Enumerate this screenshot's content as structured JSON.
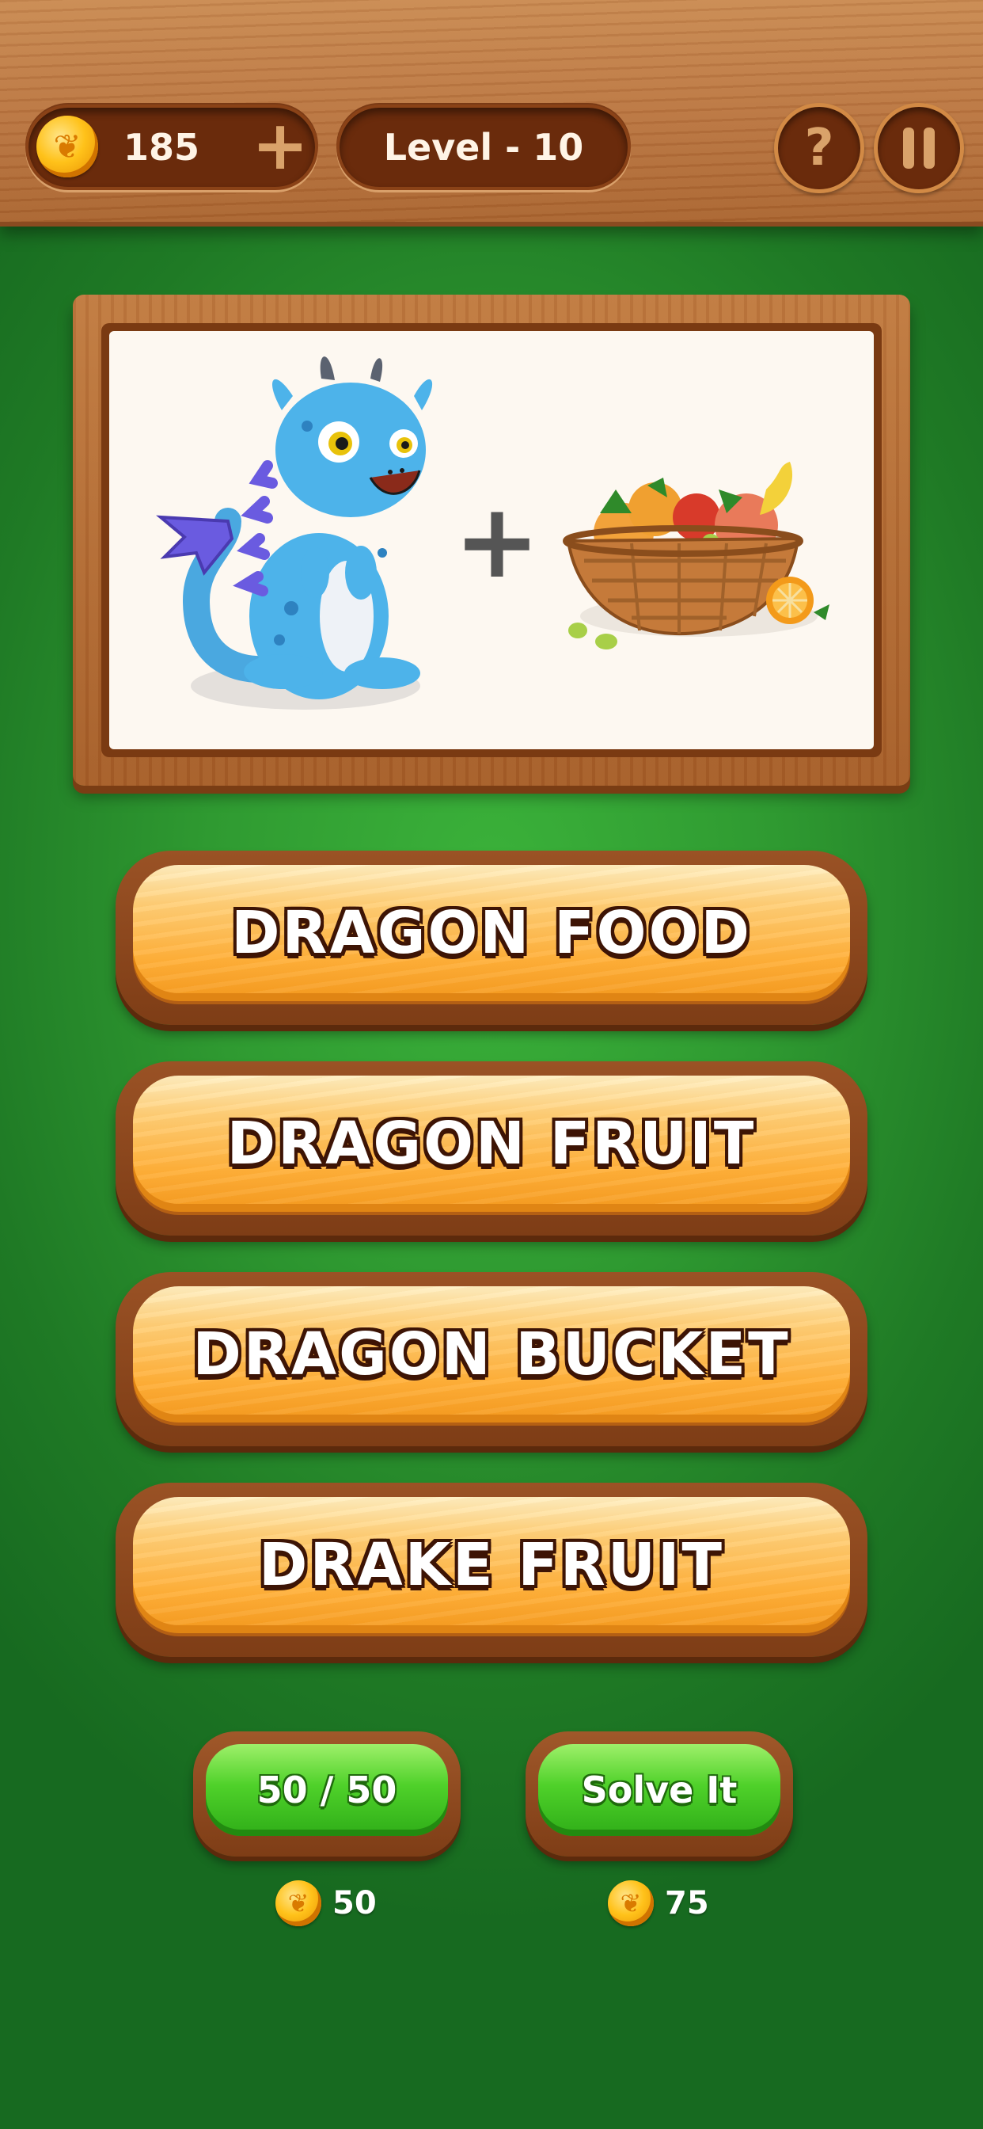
{
  "header": {
    "coins": "185",
    "add_coins_icon": "plus-icon",
    "level_label": "Level - 10",
    "help_icon": "question-icon",
    "pause_icon": "pause-icon"
  },
  "puzzle": {
    "left_image": "blue-dragon-icon",
    "operator": "+",
    "right_image": "fruit-basket-icon"
  },
  "answers": [
    "DRAGON FOOD",
    "DRAGON FRUIT",
    "DRAGON BUCKET",
    "DRAKE FRUIT"
  ],
  "hints": [
    {
      "label": "50 / 50",
      "cost": "50"
    },
    {
      "label": "Solve It",
      "cost": "75"
    }
  ],
  "colors": {
    "background_green": "#2f9a31",
    "wood": "#b8733f",
    "answer_orange": "#ffb03a",
    "hint_green": "#4fd12a",
    "coin_gold": "#ffc21a"
  }
}
